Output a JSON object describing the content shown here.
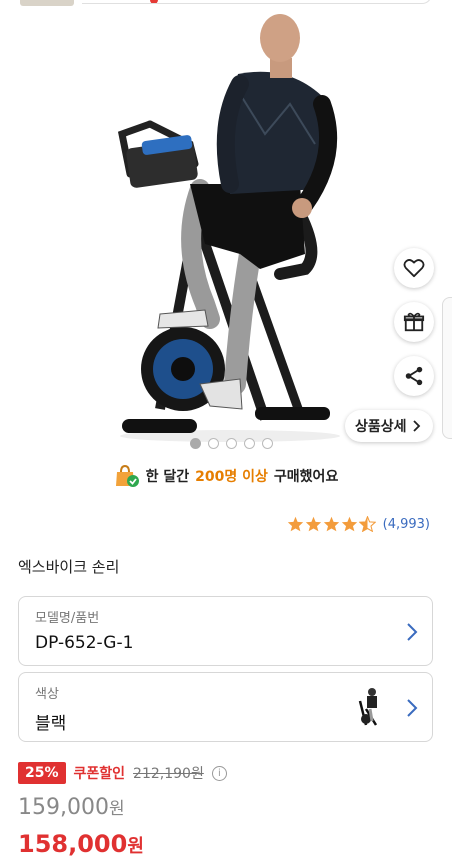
{
  "gallery": {
    "dots_total": 5,
    "active_dot": 0,
    "detail_button_label": "상품상세",
    "side_actions": [
      "heart-icon",
      "gift-icon",
      "share-icon"
    ]
  },
  "purchase_notice": {
    "prefix": "한 달간",
    "highlight": "200명 이상",
    "suffix": "구매했어요"
  },
  "rating": {
    "stars": 4.5,
    "count_text": "(4,993)"
  },
  "product": {
    "name": "엑스바이크 손리"
  },
  "options": {
    "model": {
      "label": "모델명/품번",
      "value": "DP-652-G-1"
    },
    "color": {
      "label": "색상",
      "value": "블랙"
    }
  },
  "pricing": {
    "discount_badge": "25%",
    "coupon_label": "쿠폰할인",
    "original_price": "212,190원",
    "sale_price_number": "159,000",
    "coupon_price_number": "158,000",
    "currency": "원"
  },
  "colors": {
    "accent_red": "#e03131",
    "highlight_orange": "#e67e00",
    "link_blue": "#3a6bbf",
    "star_orange": "#f39c3c"
  }
}
